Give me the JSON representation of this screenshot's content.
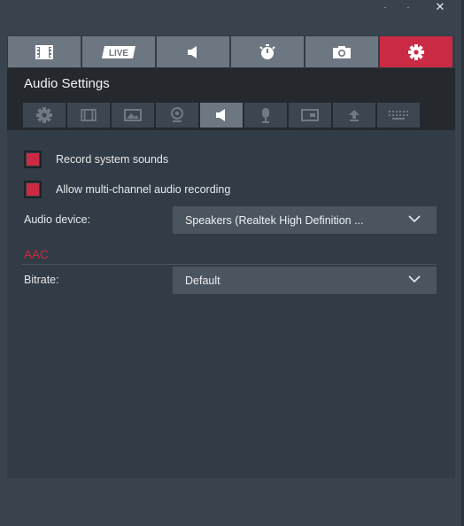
{
  "window": {
    "controls": {
      "minimize": "-",
      "maximize": "-",
      "close": "✕"
    }
  },
  "main_tabs": [
    {
      "icon": "film-icon"
    },
    {
      "icon": "live-icon",
      "label": "LIVE"
    },
    {
      "icon": "speaker-icon"
    },
    {
      "icon": "timer-icon"
    },
    {
      "icon": "camera-icon"
    },
    {
      "icon": "gear-icon",
      "active": true
    }
  ],
  "header": {
    "title": "Audio Settings"
  },
  "sub_tabs": [
    {
      "icon": "gear-icon"
    },
    {
      "icon": "film-icon"
    },
    {
      "icon": "image-icon"
    },
    {
      "icon": "webcam-icon"
    },
    {
      "icon": "speaker-icon",
      "active": true
    },
    {
      "icon": "microphone-icon"
    },
    {
      "icon": "overlay-icon"
    },
    {
      "icon": "upload-icon"
    },
    {
      "icon": "keyboard-icon"
    }
  ],
  "audio": {
    "record_system_sounds": {
      "label": "Record system sounds",
      "checked": true
    },
    "multichannel": {
      "label": "Allow multi-channel audio recording",
      "checked": true
    },
    "device": {
      "label": "Audio device:",
      "value": "Speakers (Realtek High Definition ..."
    }
  },
  "aac": {
    "title": "AAC",
    "bitrate": {
      "label": "Bitrate:",
      "value": "Default"
    }
  },
  "colors": {
    "accent": "#cb2a44",
    "tab": "#6d7781",
    "background": "#39434d",
    "header": "#25292e"
  }
}
